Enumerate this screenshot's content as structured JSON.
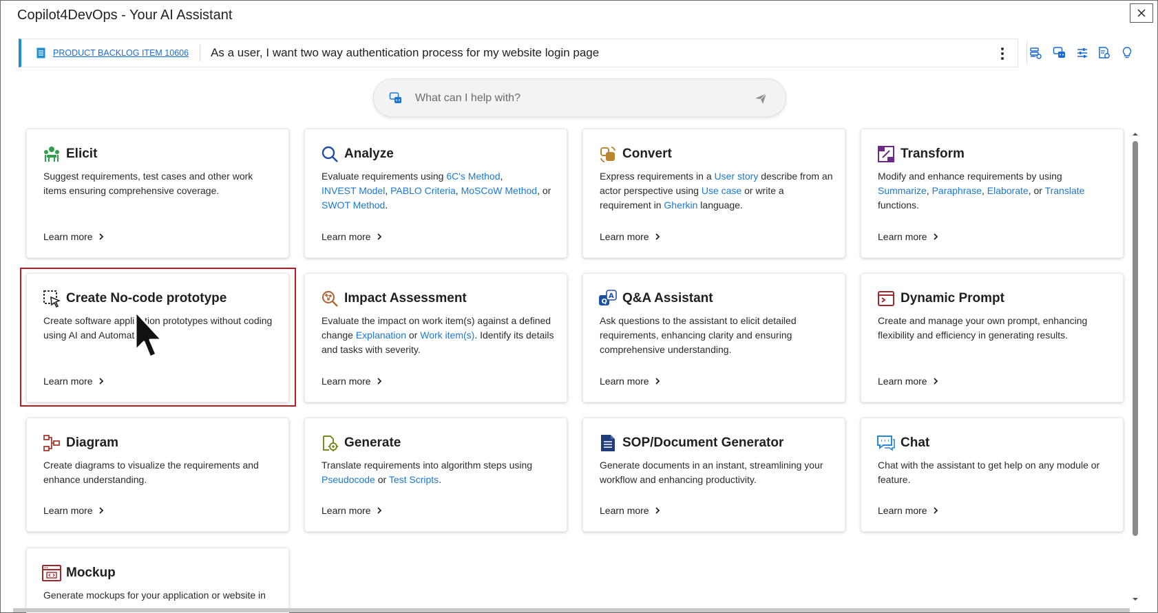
{
  "window": {
    "title": "Copilot4DevOps - Your AI Assistant",
    "close_symbol": "✕"
  },
  "work_item": {
    "link": "PRODUCT BACKLOG ITEM 10606",
    "title": "As a user, I want two way authentication process for my website login page"
  },
  "toolbar": {
    "icons": [
      "prompt-library-icon",
      "chat-assistant-icon",
      "settings-sliders-icon",
      "document-settings-icon",
      "lightbulb-icon"
    ]
  },
  "search": {
    "placeholder": "What can I help with?"
  },
  "learn_more": "Learn more",
  "cards": {
    "elicit": {
      "title": "Elicit",
      "desc": "Suggest requirements, test cases and other work items ensuring comprehensive coverage."
    },
    "analyze": {
      "title": "Analyze",
      "t1": "Evaluate requirements using ",
      "l1": "6C's Method",
      "t2": ",",
      "l2": "INVEST Model",
      "t3": ", ",
      "l3": "PABLO Criteria",
      "t4": ", ",
      "l4": "MoSCoW Method",
      "t5": ", or",
      "l5": "SWOT Method",
      "t6": "."
    },
    "convert": {
      "title": "Convert",
      "t1": "Express requirements in a ",
      "l1": "User story",
      "t2": "  describe from an actor perspective using ",
      "l2": "Use case",
      "t3": "  or write a requirement in ",
      "l3": "Gherkin",
      "t4": "  language."
    },
    "transform": {
      "title": "Transform",
      "t1": "Modify and enhance requirements by using ",
      "l1": "Summarize",
      "t2": ", ",
      "l2": "Paraphrase",
      "t3": ", ",
      "l3": "Elaborate",
      "t4": ", or ",
      "l4": "Translate",
      "t5": " functions."
    },
    "prototype": {
      "title": "Create No-code prototype",
      "desc": "Create software application prototypes without coding using AI and Automation."
    },
    "impact": {
      "title": "Impact Assessment",
      "t1": "Evaluate the impact on work item(s) against a defined change ",
      "l1": "Explanation",
      "t2": " or ",
      "l2": "Work item(s)",
      "t3": ".  Identify its details and tasks with severity."
    },
    "qa": {
      "title": "Q&A Assistant",
      "desc": "Ask questions to the assistant to elicit detailed requirements, enhancing clarity and ensuring comprehensive understanding."
    },
    "dynamic": {
      "title": "Dynamic Prompt",
      "desc": "Create and manage your own prompt, enhancing flexibility and efficiency in generating results."
    },
    "diagram": {
      "title": "Diagram",
      "desc": "Create diagrams to visualize the requirements and enhance understanding."
    },
    "generate": {
      "title": "Generate",
      "t1": "Translate requirements into algorithm steps using ",
      "l1": "Pseudocode",
      "t2": " or ",
      "l2": "Test Scripts",
      "t3": "."
    },
    "sop": {
      "title": "SOP/Document Generator",
      "desc": "Generate documents in an instant, streamlining your workflow and enhancing productivity."
    },
    "chat": {
      "title": "Chat",
      "desc": "Chat with the assistant to get help on any module or feature."
    },
    "mockup": {
      "title": "Mockup",
      "desc": "Generate mockups for your application or website in"
    }
  },
  "colors": {
    "accent": "#1a8fd1",
    "link": "#1a78d1",
    "highlight": "#c0181f"
  }
}
